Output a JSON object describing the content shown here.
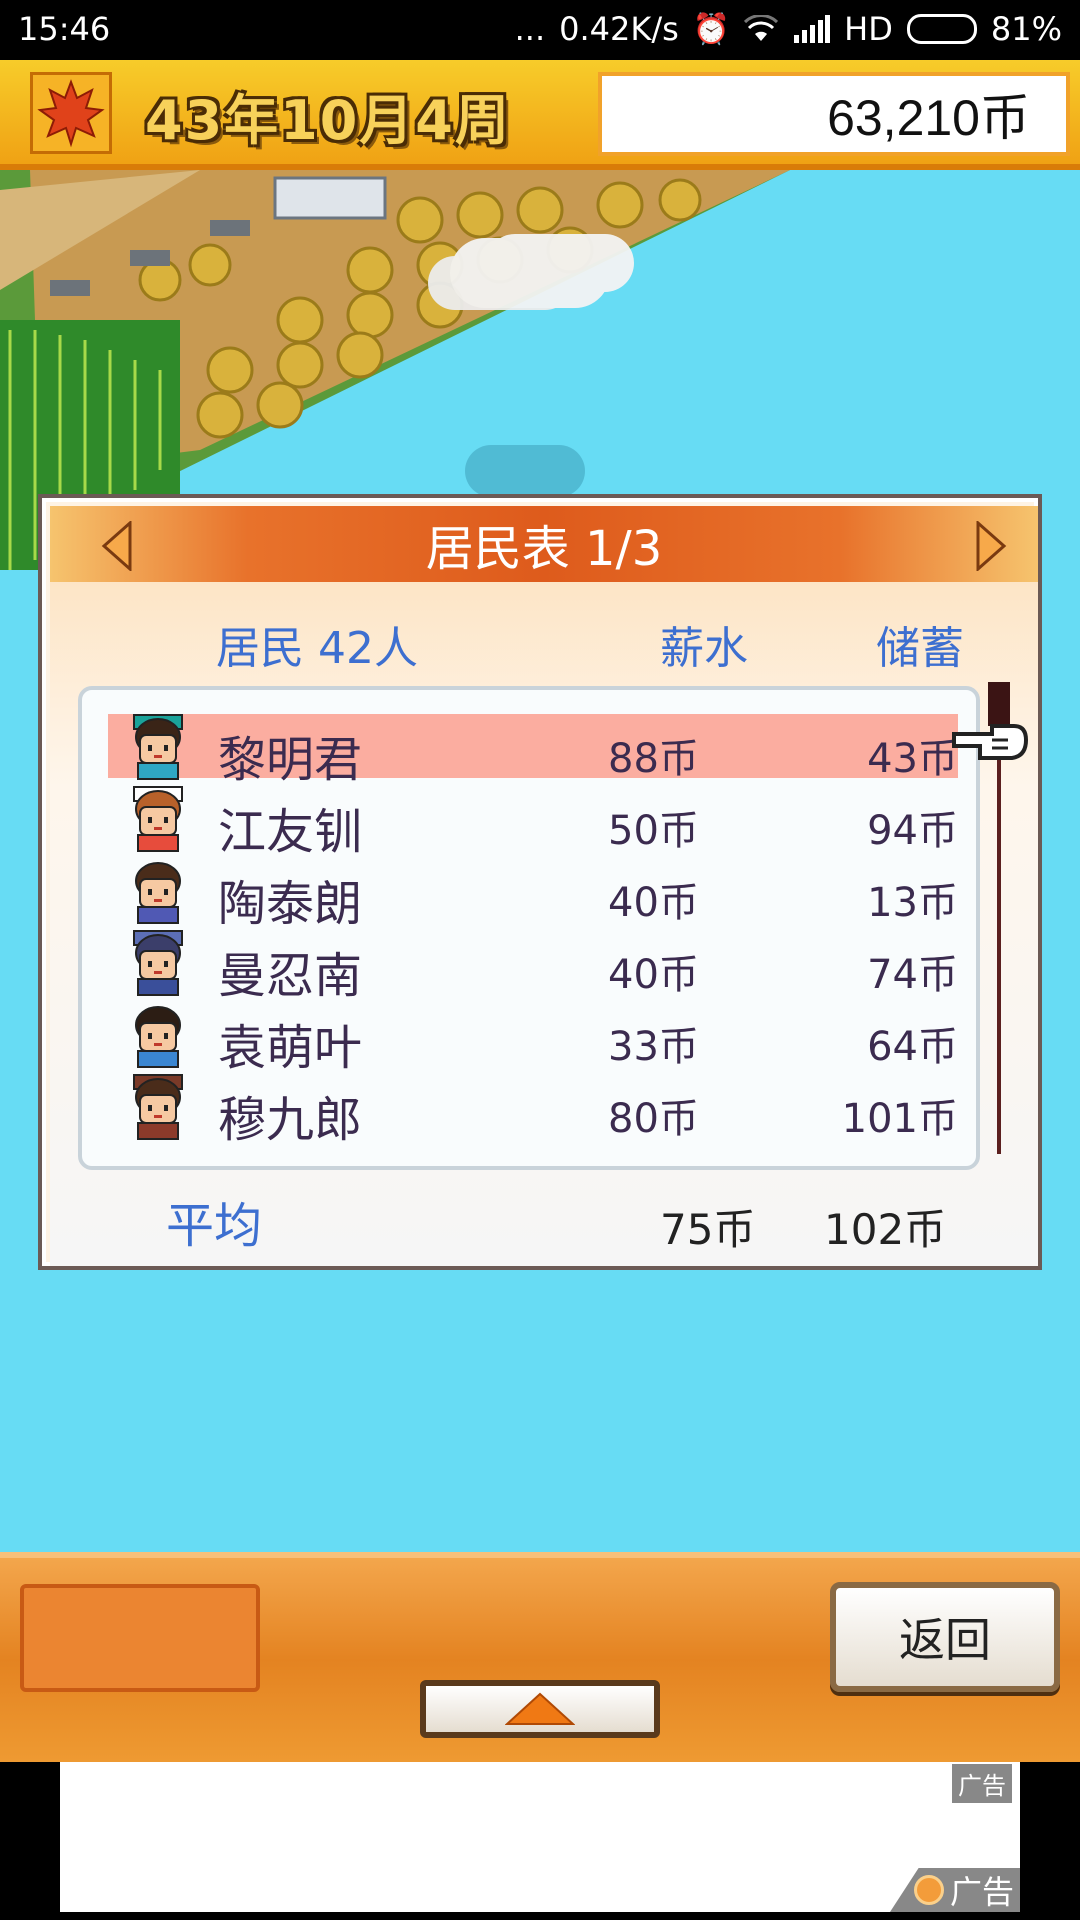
{
  "status_bar": {
    "time": "15:46",
    "dots": "...",
    "speed": "0.42K/s",
    "network": "HD",
    "battery": "81%"
  },
  "hud": {
    "date": "43年10月4周",
    "money": "63,210币",
    "season_icon": "maple-leaf-icon"
  },
  "panel": {
    "title": "居民表 1/3",
    "col_residents": "居民 42人",
    "col_salary": "薪水",
    "col_savings": "储蓄",
    "rows": [
      {
        "name": "黎明君",
        "salary": "88币",
        "savings": "43币",
        "selected": true
      },
      {
        "name": "江友钏",
        "salary": "50币",
        "savings": "94币",
        "selected": false
      },
      {
        "name": "陶泰朗",
        "salary": "40币",
        "savings": "13币",
        "selected": false
      },
      {
        "name": "曼忍南",
        "salary": "40币",
        "savings": "74币",
        "selected": false
      },
      {
        "name": "袁萌叶",
        "salary": "33币",
        "savings": "64币",
        "selected": false
      },
      {
        "name": "穆九郎",
        "salary": "80币",
        "savings": "101币",
        "selected": false
      }
    ],
    "avg_label": "平均",
    "avg_salary": "75币",
    "avg_savings": "102币"
  },
  "bottom": {
    "back_label": "返回"
  },
  "ad": {
    "tag": "广告",
    "logo_text": "广告"
  },
  "colors": {
    "sea": "#67dcf4",
    "accent_orange": "#e48321",
    "header_blue": "#3d6fd0",
    "selected_row": "#fbada0"
  }
}
